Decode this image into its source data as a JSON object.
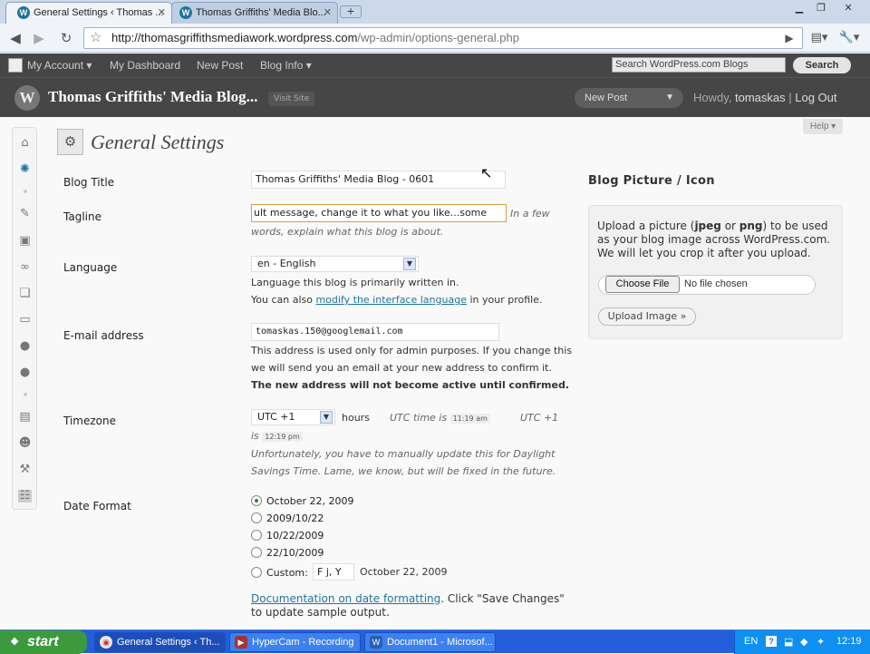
{
  "browser": {
    "tabs": [
      {
        "title": "General Settings ‹ Thomas ..."
      },
      {
        "title": "Thomas Griffiths' Media Blo..."
      }
    ],
    "url_host": "http://thomasgriffithsmediawork.wordpress.com",
    "url_path": "/wp-admin/options-general.php"
  },
  "wp_admin_bar": {
    "my_account": "My Account ▾",
    "my_dashboard": "My Dashboard",
    "new_post": "New Post",
    "blog_info": "Blog Info ▾",
    "search_placeholder": "Search WordPress.com Blogs",
    "search_button": "Search"
  },
  "wp_header": {
    "blog_name": "Thomas Griffiths' Media Blog...",
    "visit_site": "Visit Site",
    "new_post_button": "New Post",
    "howdy_prefix": "Howdy, ",
    "username": "tomaskas",
    "separator": " | ",
    "logout": "Log Out"
  },
  "help": "Help ▾",
  "page": {
    "title": "General Settings"
  },
  "form": {
    "blog_title_label": "Blog Title",
    "blog_title_value": "Thomas Griffiths' Media Blog - 0601",
    "tagline_label": "Tagline",
    "tagline_value": "ult message, change it to what you like...some",
    "tagline_desc_1": "In a few",
    "tagline_desc_2": "words, explain what this blog is about.",
    "language_label": "Language",
    "language_value": "en - English",
    "language_desc_1": "Language this blog is primarily written in.",
    "language_desc_2a": "You can also ",
    "language_desc_link": "modify the interface language",
    "language_desc_2b": " in your profile.",
    "email_label": "E-mail address",
    "email_value": "tomaskas.150@googlemail.com",
    "email_desc_1": "This address is used only for admin purposes. If you change this",
    "email_desc_2": "we will send you an email at your new address to confirm it.",
    "email_desc_3": "The new address will not become active until confirmed.",
    "timezone_label": "Timezone",
    "timezone_value": "UTC +1",
    "timezone_hours": "hours",
    "utc_time_label": "UTC time is",
    "utc_time_value": "11:19 am",
    "local_label": "UTC +1",
    "local_is": "is",
    "local_time_value": "12:19 pm",
    "timezone_note_1": "Unfortunately, you have to manually update this for Daylight",
    "timezone_note_2": "Savings Time. Lame, we know, but will be fixed in the future.",
    "date_format_label": "Date Format",
    "date_options": [
      {
        "label": "October 22, 2009",
        "selected": true
      },
      {
        "label": "2009/10/22",
        "selected": false
      },
      {
        "label": "10/22/2009",
        "selected": false
      },
      {
        "label": "22/10/2009",
        "selected": false
      }
    ],
    "custom_label": "Custom:",
    "custom_value": "F j, Y",
    "custom_preview": "October 22, 2009",
    "doc_link": "Documentation on date formatting",
    "doc_text_1": ". Click \"Save Changes\"",
    "doc_text_2": "to update sample output."
  },
  "blog_picture": {
    "title": "Blog Picture / Icon",
    "line1_a": "Upload a picture (",
    "line1_jpeg": "jpeg",
    "line1_or": " or ",
    "line1_png": "png",
    "line1_b": ") to be used",
    "line2": "as your blog image across WordPress.com.",
    "line3": "We will let you crop it after you upload.",
    "choose_file": "Choose File",
    "no_file": "No file chosen",
    "upload_button": "Upload Image »"
  },
  "taskbar": {
    "start": "start",
    "items": [
      {
        "label": "General Settings ‹ Th..."
      },
      {
        "label": "HyperCam - Recording"
      },
      {
        "label": "Document1 - Microsof..."
      }
    ],
    "lang": "EN",
    "clock": "12:19"
  },
  "colors": {
    "admin_bar": "#464646",
    "link": "#21759b",
    "taskbar": "#245edb",
    "start": "#3c9a3c"
  }
}
